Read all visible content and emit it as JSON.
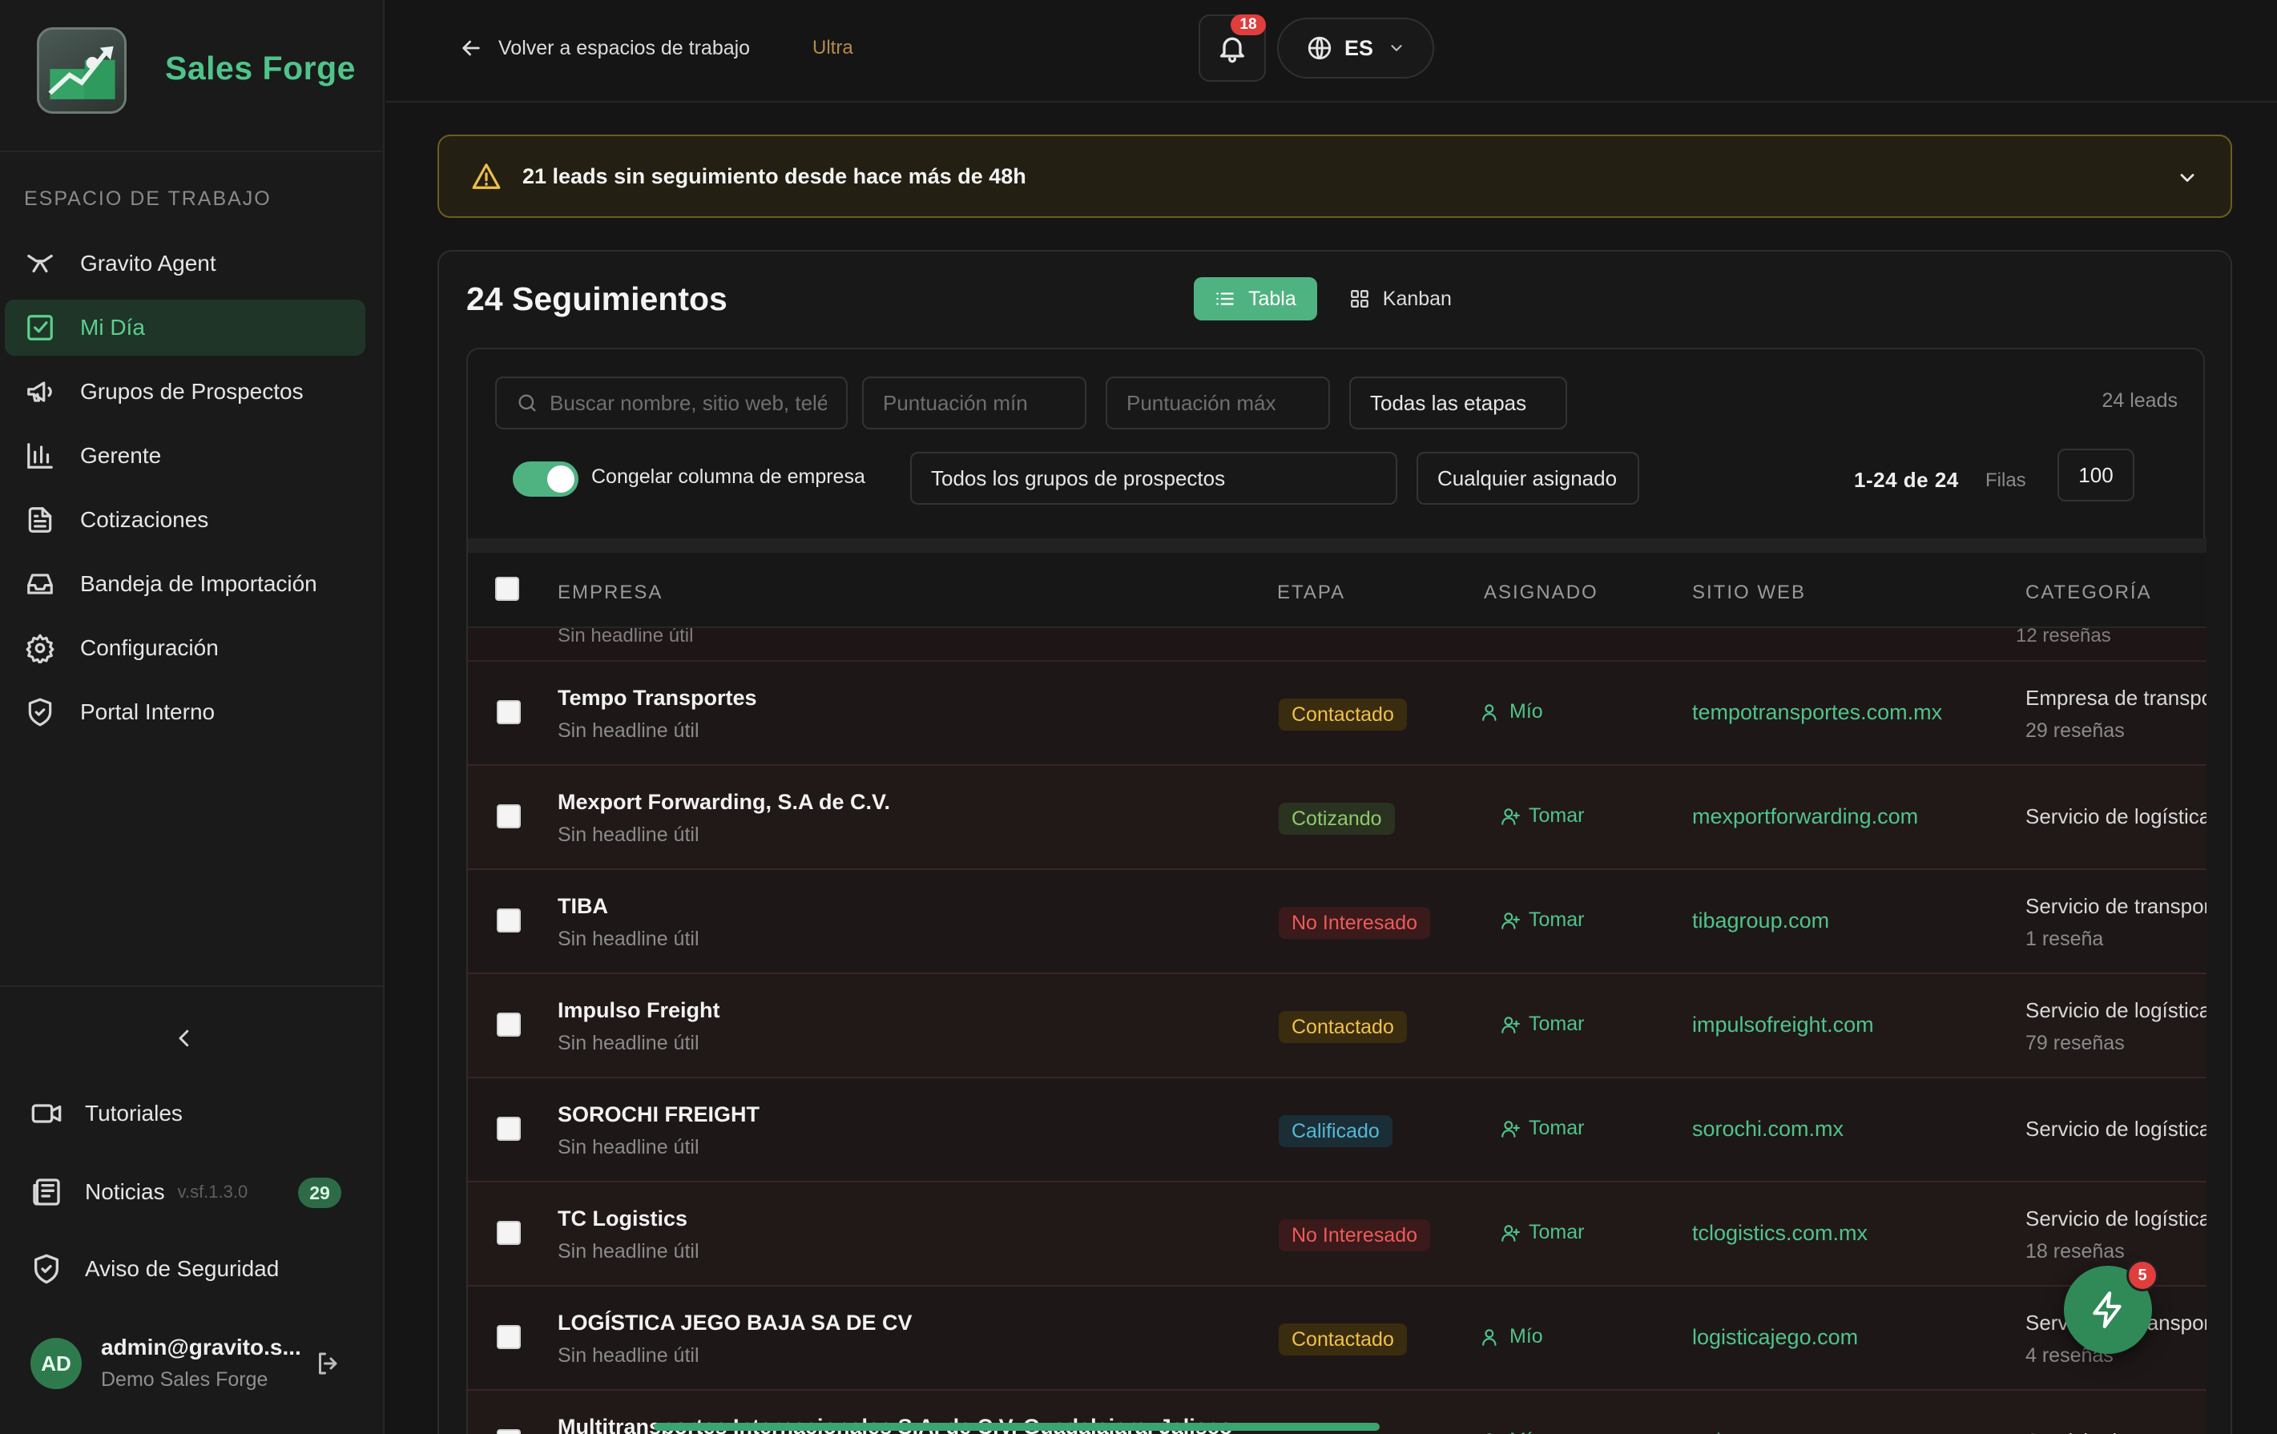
{
  "brand": {
    "name": "Sales Forge"
  },
  "sidebar": {
    "section_label": "ESPACIO DE TRABAJO",
    "items": [
      {
        "label": "Gravito Agent",
        "icon": "agent-icon",
        "active": false
      },
      {
        "label": "Mi Día",
        "icon": "checkbox-icon",
        "active": true
      },
      {
        "label": "Grupos de Prospectos",
        "icon": "megaphone-icon",
        "active": false
      },
      {
        "label": "Gerente",
        "icon": "bar-chart-icon",
        "active": false
      },
      {
        "label": "Cotizaciones",
        "icon": "document-icon",
        "active": false
      },
      {
        "label": "Bandeja de Importación",
        "icon": "inbox-icon",
        "active": false
      },
      {
        "label": "Configuración",
        "icon": "gear-icon",
        "active": false
      },
      {
        "label": "Portal Interno",
        "icon": "shield-icon",
        "active": false
      }
    ],
    "bottom": {
      "tutorials": "Tutoriales",
      "news": "Noticias",
      "version": "v.sf.1.3.0",
      "news_count": "29",
      "security": "Aviso de Seguridad"
    },
    "user": {
      "initials": "AD",
      "email": "admin@gravito.s...",
      "org": "Demo Sales Forge"
    }
  },
  "topbar": {
    "back_label": "Volver a espacios de trabajo",
    "plan": "Ultra",
    "notifications_count": "18",
    "language": "ES"
  },
  "alert": {
    "text": "21 leads sin seguimiento desde hace más de 48h"
  },
  "main": {
    "title": "24 Seguimientos",
    "tabs": [
      {
        "label": "Tabla",
        "active": true
      },
      {
        "label": "Kanban",
        "active": false
      }
    ]
  },
  "filters": {
    "search_placeholder": "Buscar nombre, sitio web, teléfono",
    "score_min_placeholder": "Puntuación mín",
    "score_max_placeholder": "Puntuación máx",
    "stage": "Todas las etapas",
    "lead_count": "24 leads",
    "freeze_label": "Congelar columna de empresa",
    "freeze_on": true,
    "groups": "Todos los grupos de prospectos",
    "assignee": "Cualquier asignado",
    "range": "1-24 de 24",
    "rows_label": "Filas",
    "rows_value": "100"
  },
  "table": {
    "columns": [
      "EMPRESA",
      "ETAPA",
      "ASIGNADO",
      "SITIO WEB",
      "CATEGORÍA"
    ],
    "partial_top": {
      "sub": "Sin headline útil",
      "reviews": "12 reseñas"
    },
    "rows": [
      {
        "name": "Tempo Transportes",
        "sub": "Sin headline útil",
        "stage": "Contactado",
        "stage_kind": "contactado",
        "assigned": "Mío",
        "assign_kind": "mio",
        "site": "tempotransportes.com.mx",
        "category": "Empresa de transporte",
        "reviews": "29 reseñas"
      },
      {
        "name": "Mexport Forwarding, S.A de C.V.",
        "sub": "Sin headline útil",
        "stage": "Cotizando",
        "stage_kind": "cotizando",
        "assigned": "Tomar",
        "assign_kind": "tomar",
        "site": "mexportforwarding.com",
        "category": "Servicio de logística",
        "reviews": ""
      },
      {
        "name": "TIBA",
        "sub": "Sin headline útil",
        "stage": "No Interesado",
        "stage_kind": "nointeresado",
        "assigned": "Tomar",
        "assign_kind": "tomar",
        "site": "tibagroup.com",
        "category": "Servicio de transporte",
        "reviews": "1 reseña"
      },
      {
        "name": "Impulso Freight",
        "sub": "Sin headline útil",
        "stage": "Contactado",
        "stage_kind": "contactado",
        "assigned": "Tomar",
        "assign_kind": "tomar",
        "site": "impulsofreight.com",
        "category": "Servicio de logística",
        "reviews": "79 reseñas"
      },
      {
        "name": "SOROCHI FREIGHT",
        "sub": "Sin headline útil",
        "stage": "Calificado",
        "stage_kind": "calificado",
        "assigned": "Tomar",
        "assign_kind": "tomar",
        "site": "sorochi.com.mx",
        "category": "Servicio de logística",
        "reviews": ""
      },
      {
        "name": "TC Logistics",
        "sub": "Sin headline útil",
        "stage": "No Interesado",
        "stage_kind": "nointeresado",
        "assigned": "Tomar",
        "assign_kind": "tomar",
        "site": "tclogistics.com.mx",
        "category": "Servicio de logística",
        "reviews": "18 reseñas"
      },
      {
        "name": "LOGÍSTICA JEGO BAJA SA DE CV",
        "sub": "Sin headline útil",
        "stage": "Contactado",
        "stage_kind": "contactado",
        "assigned": "Mío",
        "assign_kind": "mio",
        "site": "logisticajego.com",
        "category": "Servicio de transporte",
        "reviews": "4 reseñas"
      },
      {
        "name": "Multitransportes Internacionales S.A. de C.V. Guadalajara, Jalisco",
        "sub": "",
        "stage": "",
        "stage_kind": "contactado",
        "assigned": "Mío",
        "assign_kind": "mio",
        "site": "mtinter.com.mx",
        "category": "Servicio de transporte",
        "reviews": ""
      }
    ]
  },
  "fab": {
    "badge": "5"
  },
  "colors": {
    "accent": "#4fb381",
    "brand": "#4fc48a",
    "warning": "#f0c04d",
    "danger": "#e03d3d"
  }
}
